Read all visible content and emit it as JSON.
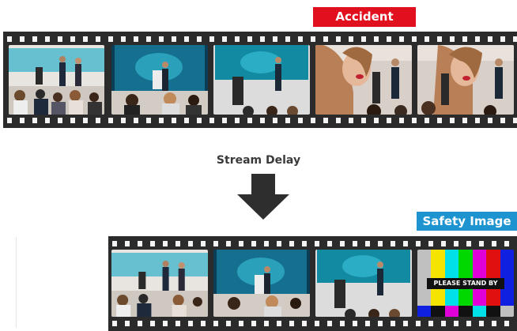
{
  "accident_label": "Accident",
  "stream_delay_label": "Stream Delay",
  "safety_image_label": "Safety Image",
  "test_card_text": "PLEASE STAND BY",
  "colors": {
    "film": "#2b2b2b",
    "accident_tag": "#e0101f",
    "safety_tag": "#1d93d0",
    "screen": "#1aa0b8",
    "arrow": "#2e2e2e"
  },
  "test_card_bars": [
    "#c0c0c0",
    "#f4e400",
    "#00e0e8",
    "#00d800",
    "#e000d8",
    "#e01010",
    "#1020e0"
  ],
  "live_stream_frames": [
    "conference-speakers",
    "conference-podium",
    "conference-screen",
    "accident-close-up",
    "accident-close-up"
  ],
  "delayed_stream_frames": [
    "conference-speakers",
    "conference-podium",
    "conference-screen",
    "safety-test-card"
  ],
  "icons": [
    "down-arrow-icon"
  ]
}
